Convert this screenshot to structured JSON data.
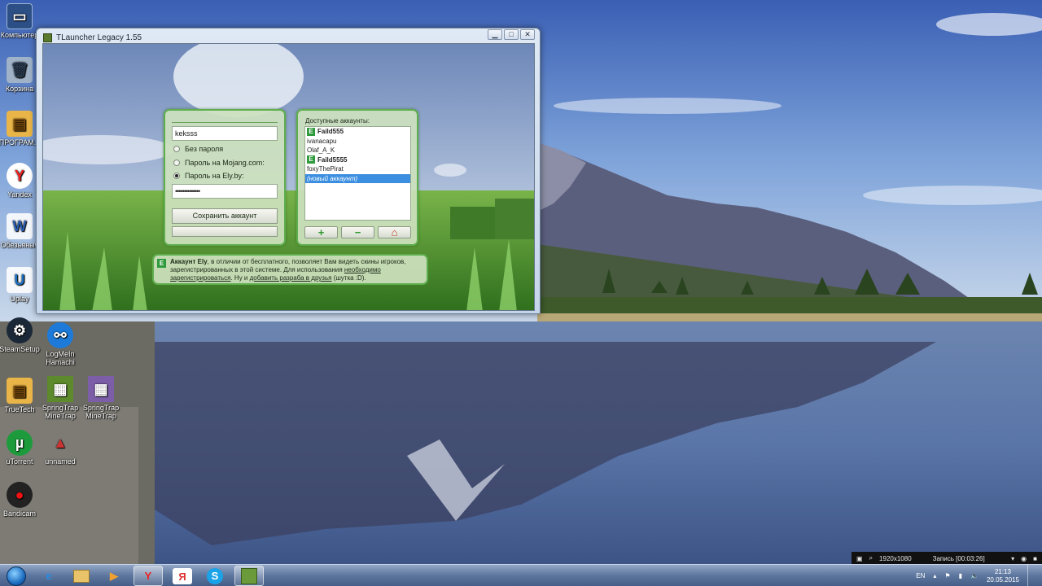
{
  "desktop": {
    "icons": [
      {
        "label": "Компьютер",
        "icon": "computer-icon"
      },
      {
        "label": "Корзина",
        "icon": "recycle-bin-icon"
      },
      {
        "label": "ПРОГРАМ...",
        "icon": "folder-icon"
      },
      {
        "label": "Yandex",
        "icon": "yandex-browser-icon"
      },
      {
        "label": "Обезьяныч",
        "icon": "word-document-icon"
      },
      {
        "label": "Uplay",
        "icon": "uplay-icon"
      },
      {
        "label": "SteamSetup",
        "icon": "steam-icon"
      },
      {
        "label": "LogMeIn Hamachi",
        "icon": "hamachi-icon"
      },
      {
        "label": "TrueTech",
        "icon": "folder-icon"
      },
      {
        "label": "SpringTrap MineTrap",
        "icon": "minecraft-skin-icon"
      },
      {
        "label": "SpringTrap MineTrap",
        "icon": "minecraft-skin-icon"
      },
      {
        "label": "uTorrent",
        "icon": "utorrent-icon"
      },
      {
        "label": "unnamed",
        "icon": "image-icon"
      },
      {
        "label": "Bandicam",
        "icon": "bandicam-icon"
      }
    ]
  },
  "window": {
    "title": "TLauncher Legacy 1.55",
    "min": "▁",
    "max": "□",
    "close": "✕"
  },
  "login": {
    "username": "keksss",
    "option_no_password": "Без пароля",
    "option_mojang": "Пароль на Mojang.com:",
    "option_ely": "Пароль на Ely.by:",
    "password_mask": "••••••••••••••",
    "save_button": "Сохранить аккаунт"
  },
  "accounts": {
    "label": "Доступные аккаунты:",
    "items": [
      {
        "name": "Faild555",
        "ely": true
      },
      {
        "name": "ivanacapu",
        "ely": false
      },
      {
        "name": "Olaf_A_K",
        "ely": false
      },
      {
        "name": "Faild5555",
        "ely": true
      },
      {
        "name": "foxyThePirat",
        "ely": false
      },
      {
        "name": "(новый аккаунт)",
        "ely": false
      }
    ],
    "add_button": "+",
    "remove_button": "−",
    "home_button": "⌂"
  },
  "info": {
    "badge": "E",
    "title": "Аккаунт Ely",
    "text1": ", в отличии от бесплатного, позволяет Вам видеть скины игроков, зарегистрированных в этой системе. Для использования ",
    "link1": "необходимо зарегистрироваться",
    "text2": ". Ну и ",
    "link2": "добавить разраба в друзья",
    "text3": " (шутка :D)."
  },
  "recorder": {
    "resolution": "1920x1080",
    "status": "Запись [00:03:26]"
  },
  "taskbar": {
    "items": [
      {
        "icon": "internet-explorer-icon",
        "glyph": "e"
      },
      {
        "icon": "explorer-folder-icon",
        "glyph": ""
      },
      {
        "icon": "media-player-icon",
        "glyph": "▶"
      },
      {
        "icon": "yandex-browser-icon",
        "glyph": "Y"
      },
      {
        "icon": "yandex-icon",
        "glyph": "Я"
      },
      {
        "icon": "skype-icon",
        "glyph": "S"
      },
      {
        "icon": "minecraft-icon",
        "glyph": ""
      }
    ],
    "lang": "EN",
    "time": "21:13",
    "date": "20.05.2015"
  }
}
